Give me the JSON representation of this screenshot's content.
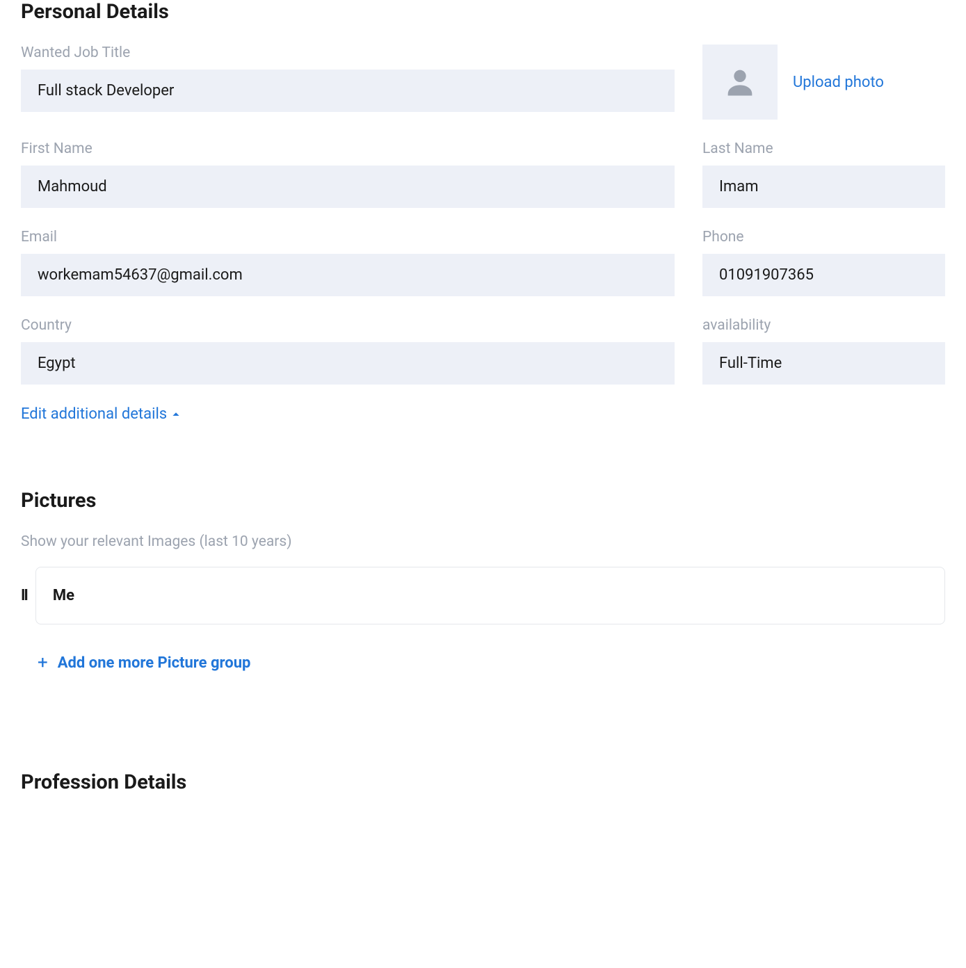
{
  "personal": {
    "title": "Personal Details",
    "jobTitle": {
      "label": "Wanted Job Title",
      "value": "Full stack Developer"
    },
    "uploadPhoto": "Upload photo",
    "firstName": {
      "label": "First Name",
      "value": "Mahmoud"
    },
    "lastName": {
      "label": "Last Name",
      "value": "Imam"
    },
    "email": {
      "label": "Email",
      "value": "workemam54637@gmail.com"
    },
    "phone": {
      "label": "Phone",
      "value": "01091907365"
    },
    "country": {
      "label": "Country",
      "value": "Egypt"
    },
    "availability": {
      "label": "availability",
      "value": "Full-Time"
    },
    "editLink": "Edit additional details"
  },
  "pictures": {
    "title": "Pictures",
    "subtitle": "Show your relevant Images (last 10 years)",
    "items": [
      {
        "title": "Me"
      }
    ],
    "addButton": "Add one more Picture group"
  },
  "profession": {
    "title": "Profession Details"
  }
}
